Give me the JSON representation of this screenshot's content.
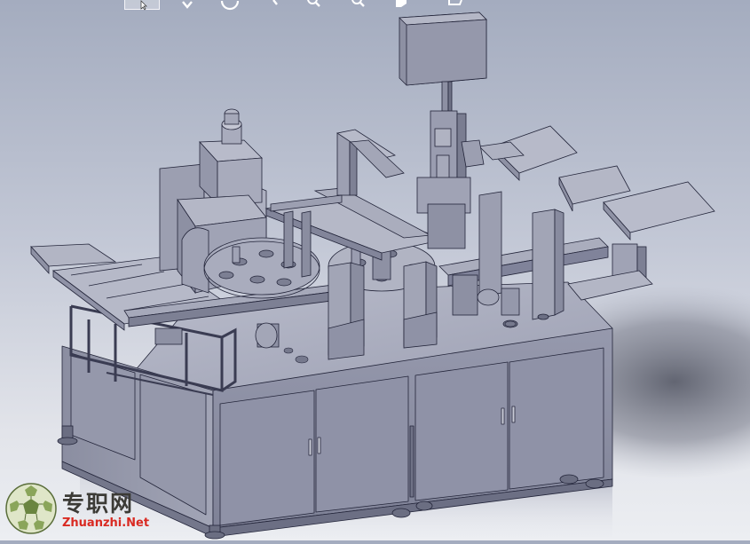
{
  "view_toolbar": {
    "items": [
      {
        "name": "select-cursor",
        "icon": "cursor-icon",
        "selected": true
      },
      {
        "name": "zoom-fit",
        "icon": "zoom-fit-icon"
      },
      {
        "name": "rotate-view",
        "icon": "rotate-icon"
      },
      {
        "name": "pan-view",
        "icon": "pan-icon"
      },
      {
        "name": "zoom-in-out",
        "icon": "zoom-in-out-icon"
      },
      {
        "name": "zoom-area",
        "icon": "zoom-area-icon"
      },
      {
        "name": "previous-view",
        "icon": "previous-view-icon"
      },
      {
        "name": "section-view",
        "icon": "section-view-icon"
      }
    ]
  },
  "watermark": {
    "chinese": "专职网",
    "url": "Zhuanzhi.Net",
    "logo_icon": "soccer-ball-logo-icon",
    "colors": {
      "chinese": "#3c3b36",
      "url": "#d92a22"
    }
  },
  "model": {
    "description_icon": "automated-assembly-machine-3d-model",
    "shade": "#8c8fa6"
  }
}
